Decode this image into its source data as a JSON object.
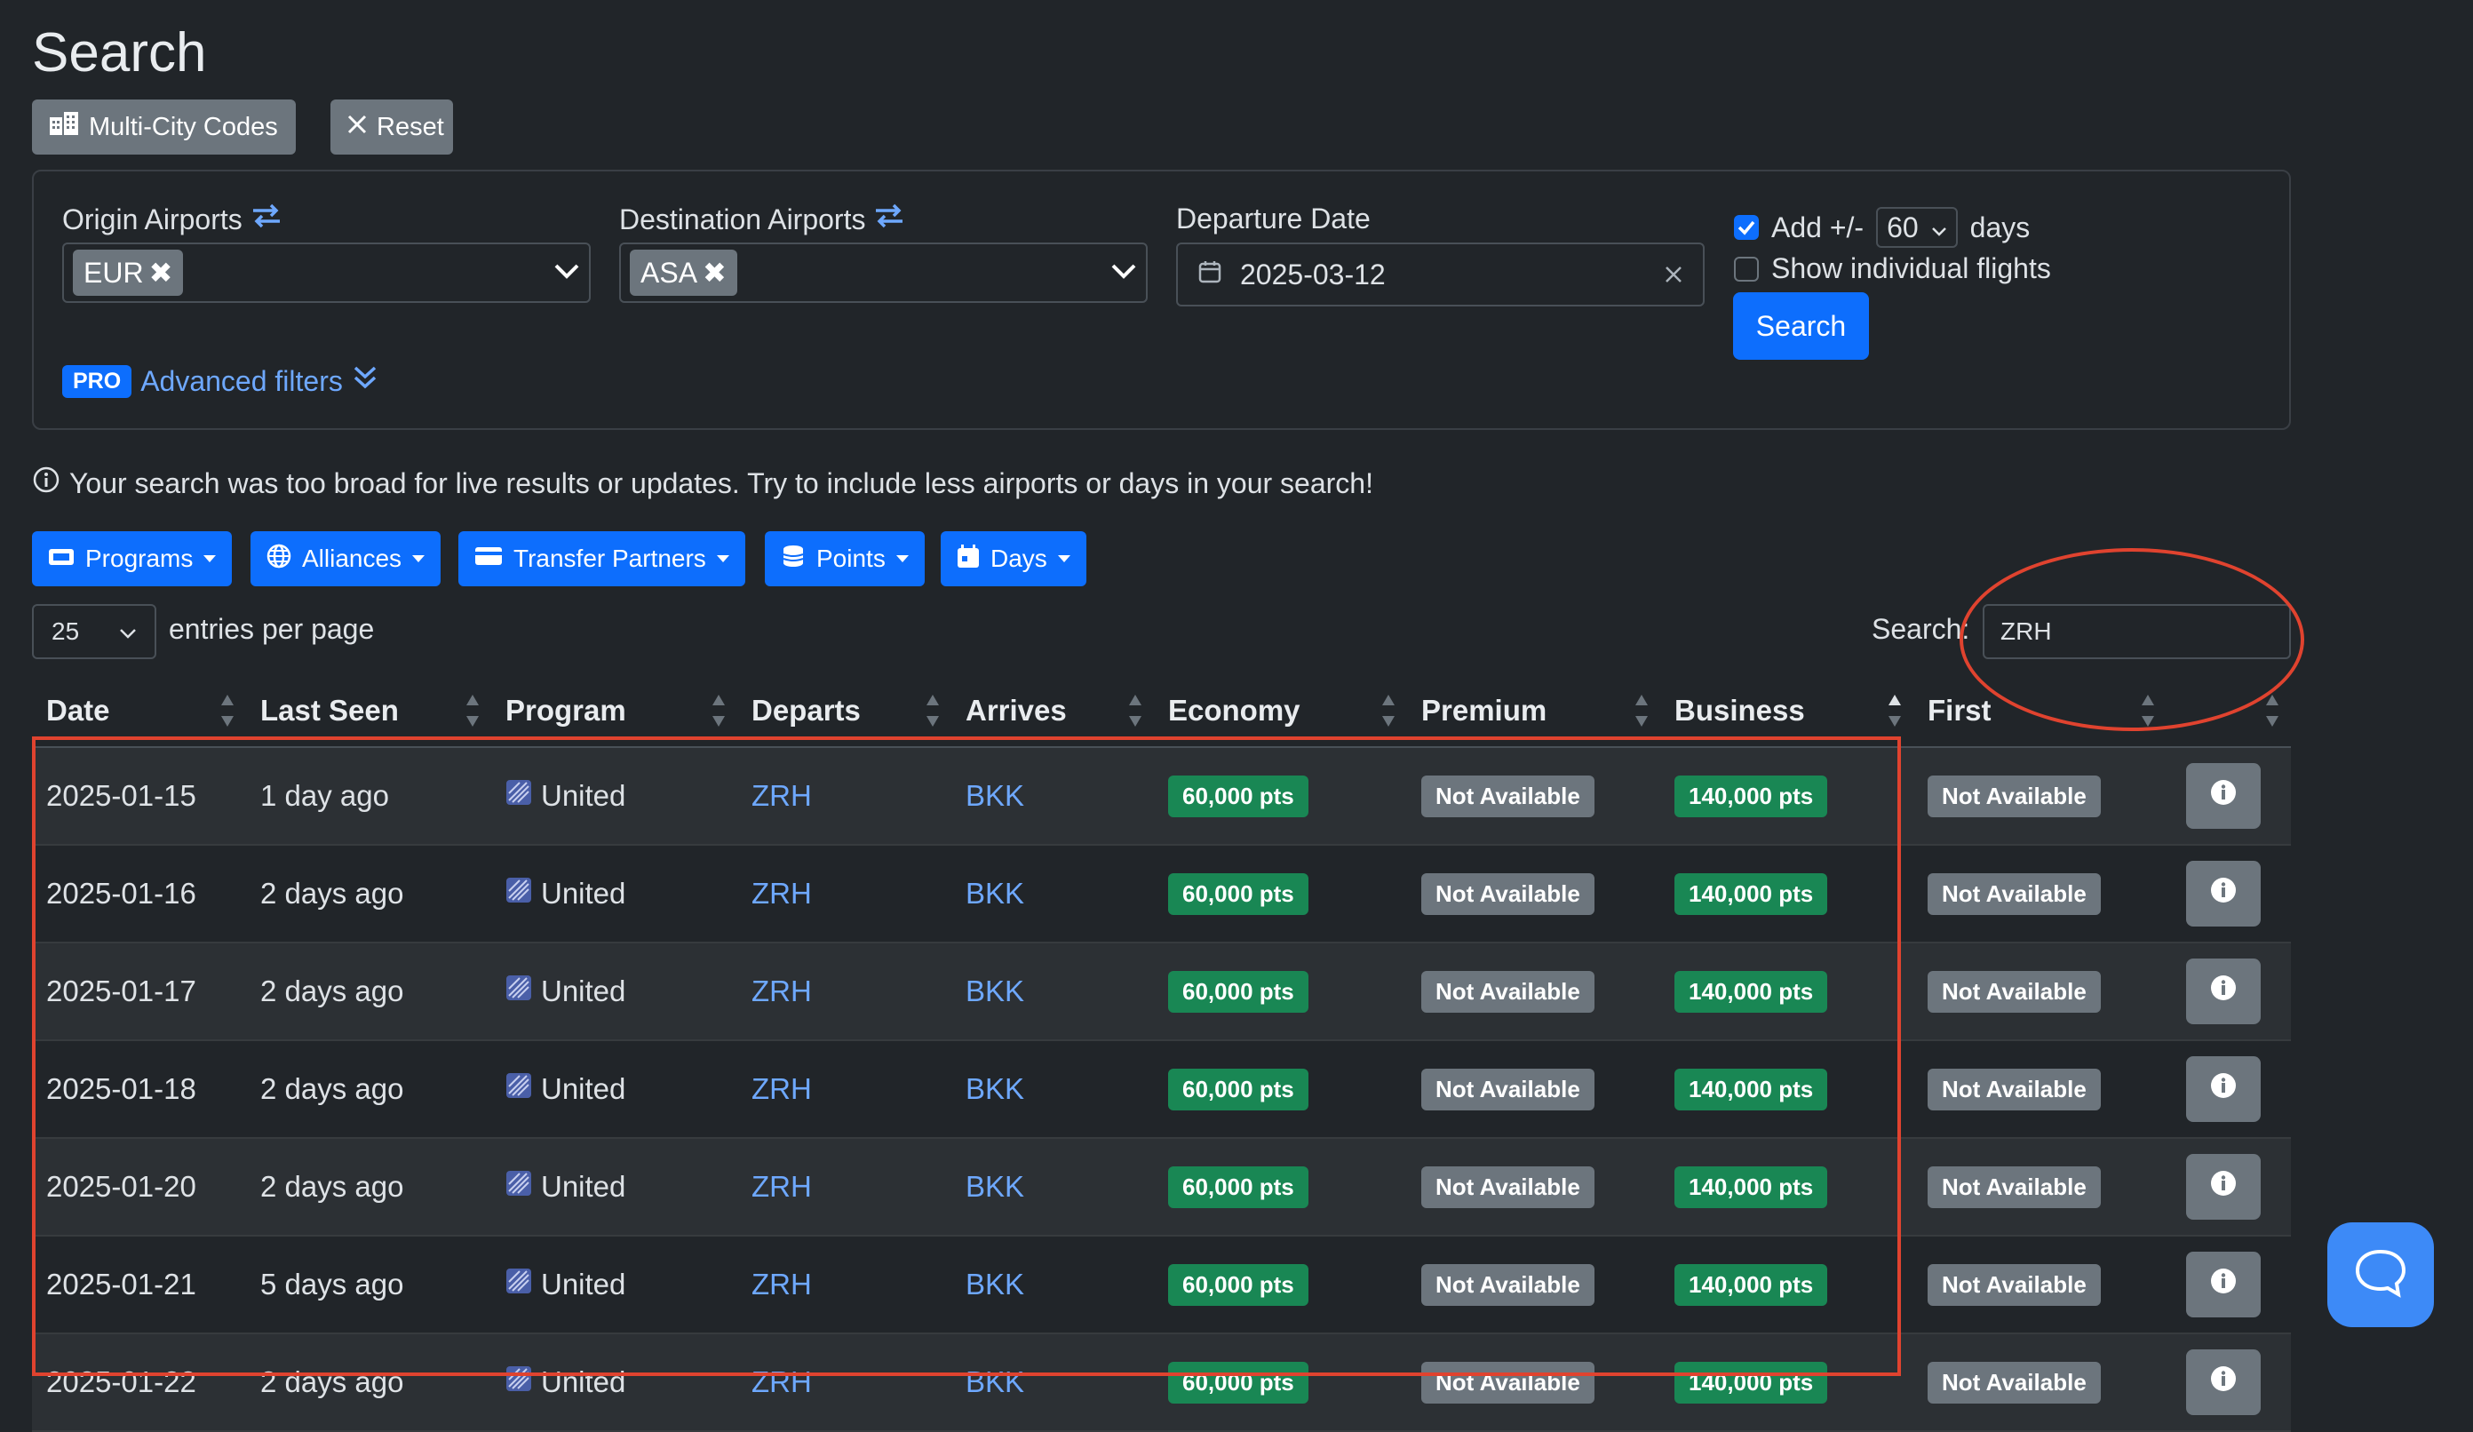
{
  "page": {
    "title": "Search"
  },
  "toolbar": {
    "multi_city_label": "Multi-City Codes",
    "reset_label": "Reset"
  },
  "form": {
    "origin_label": "Origin Airports",
    "origin_chip": "EUR",
    "destination_label": "Destination Airports",
    "destination_chip": "ASA",
    "departure_label": "Departure Date",
    "departure_value": "2025-03-12",
    "add_days_checked": true,
    "add_days_label": "Add +/-",
    "add_days_value": "60",
    "days_label": "days",
    "show_individual_label": "Show individual flights",
    "show_individual_checked": false,
    "search_button": "Search",
    "pro_badge": "PRO",
    "advanced_filters": "Advanced filters"
  },
  "alert": {
    "text": "Your search was too broad for live results or updates. Try to include less airports or days in your search!"
  },
  "filters": [
    "Programs",
    "Alliances",
    "Transfer Partners",
    "Points",
    "Days"
  ],
  "table_controls": {
    "entries_value": "25",
    "entries_label": "entries per page",
    "search_label": "Search:",
    "search_value": "ZRH"
  },
  "table": {
    "columns": [
      "Date",
      "Last Seen",
      "Program",
      "Departs",
      "Arrives",
      "Economy",
      "Premium",
      "Business",
      "First",
      ""
    ],
    "sorted_column": "Business",
    "rows": [
      [
        "2025-01-15",
        "1 day ago",
        "United",
        "ZRH",
        "BKK",
        "60,000 pts",
        "Not Available",
        "140,000 pts",
        "Not Available"
      ],
      [
        "2025-01-16",
        "2 days ago",
        "United",
        "ZRH",
        "BKK",
        "60,000 pts",
        "Not Available",
        "140,000 pts",
        "Not Available"
      ],
      [
        "2025-01-17",
        "2 days ago",
        "United",
        "ZRH",
        "BKK",
        "60,000 pts",
        "Not Available",
        "140,000 pts",
        "Not Available"
      ],
      [
        "2025-01-18",
        "2 days ago",
        "United",
        "ZRH",
        "BKK",
        "60,000 pts",
        "Not Available",
        "140,000 pts",
        "Not Available"
      ],
      [
        "2025-01-20",
        "2 days ago",
        "United",
        "ZRH",
        "BKK",
        "60,000 pts",
        "Not Available",
        "140,000 pts",
        "Not Available"
      ],
      [
        "2025-01-21",
        "5 days ago",
        "United",
        "ZRH",
        "BKK",
        "60,000 pts",
        "Not Available",
        "140,000 pts",
        "Not Available"
      ],
      [
        "2025-01-22",
        "2 days ago",
        "United",
        "ZRH",
        "BKK",
        "60,000 pts",
        "Not Available",
        "140,000 pts",
        "Not Available"
      ]
    ]
  },
  "colors": {
    "accent": "#0d6efd",
    "available": "#198754",
    "unavailable": "#6c757d",
    "annotation": "#e0432f",
    "background": "#212529"
  }
}
